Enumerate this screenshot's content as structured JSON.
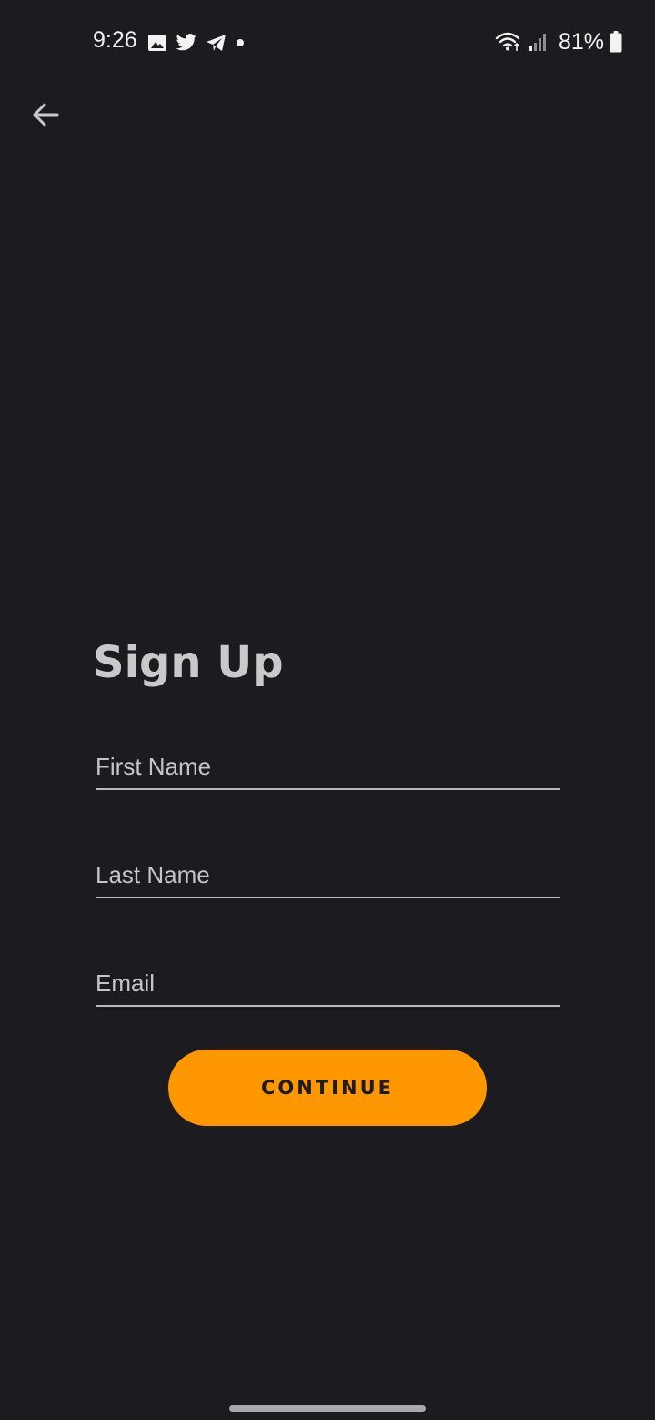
{
  "status_bar": {
    "time": "9:26",
    "battery_percent": "81%",
    "left_icons": [
      "gallery-icon",
      "twitter-icon",
      "telegram-icon",
      "notification-dot-icon"
    ],
    "right_icons": [
      "wifi-icon",
      "signal-icon",
      "battery-icon"
    ]
  },
  "header": {
    "back_icon": "arrow-left-icon"
  },
  "form": {
    "title": "Sign Up",
    "fields": [
      {
        "name": "first-name",
        "placeholder": "First Name",
        "value": ""
      },
      {
        "name": "last-name",
        "placeholder": "Last Name",
        "value": ""
      },
      {
        "name": "email",
        "placeholder": "Email",
        "value": ""
      }
    ],
    "continue_label": "CONTINUE"
  },
  "colors": {
    "background": "#1c1b20",
    "accent": "#ff9800",
    "title": "#c9c9cb",
    "underline": "#b9b9bc"
  }
}
